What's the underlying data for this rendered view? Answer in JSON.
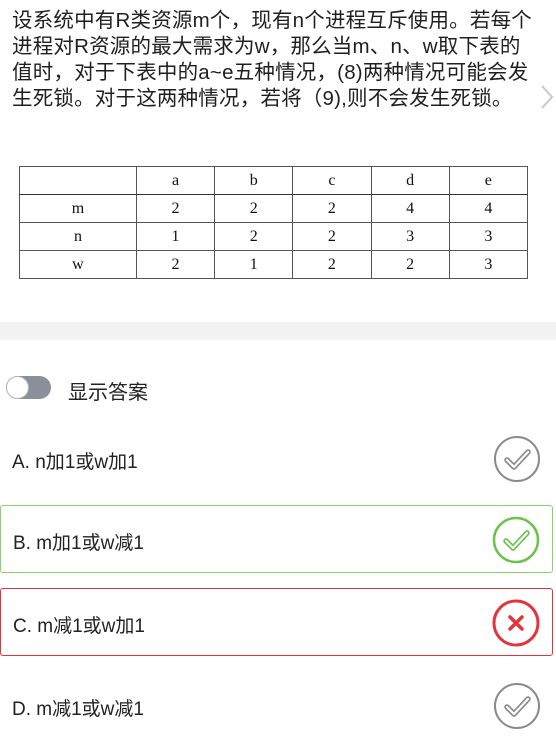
{
  "question": {
    "text": "设系统中有R类资源m个，现有n个进程互斥使用。若每个进程对R资源的最大需求为w，那么当m、n、w取下表的值时，对于下表中的a~e五种情况，(8)两种情况可能会发生死锁。对于这两种情况，若将（9),则不会发生死锁。"
  },
  "table": {
    "headers": [
      "",
      "a",
      "b",
      "c",
      "d",
      "e"
    ],
    "rows": [
      [
        "m",
        "2",
        "2",
        "2",
        "4",
        "4"
      ],
      [
        "n",
        "1",
        "2",
        "2",
        "3",
        "3"
      ],
      [
        "w",
        "2",
        "1",
        "2",
        "2",
        "3"
      ]
    ]
  },
  "toggle": {
    "label": "显示答案",
    "state": "off"
  },
  "options": [
    {
      "text": "A. n加1或w加1",
      "status": "neutral",
      "icon": "check-circle-gray-icon"
    },
    {
      "text": "B. m加1或w减1",
      "status": "correct",
      "icon": "check-circle-green-icon"
    },
    {
      "text": "C. m减1或w加1",
      "status": "wrong",
      "icon": "x-circle-red-icon"
    },
    {
      "text": "D. m减1或w减1",
      "status": "neutral",
      "icon": "check-circle-gray-icon"
    }
  ],
  "colors": {
    "correct": "#6cc24a",
    "wrong": "#e3343a",
    "neutral": "#8a8a8a",
    "toggle_track": "#8a8f99"
  }
}
